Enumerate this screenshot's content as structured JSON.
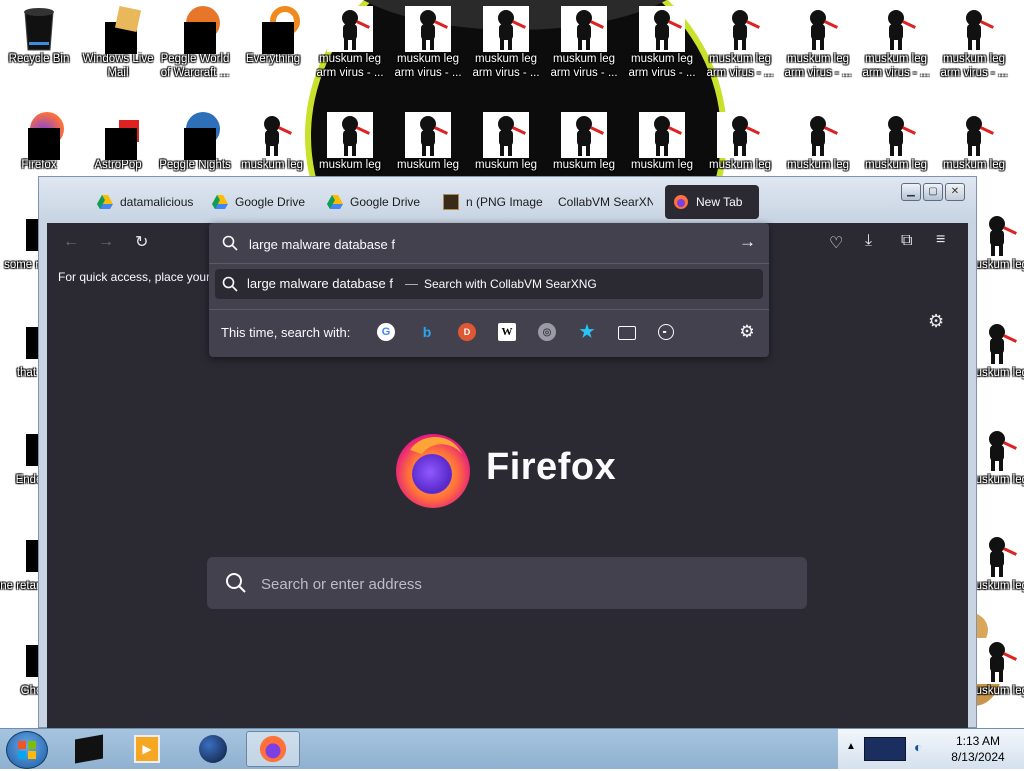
{
  "desktop": {
    "icons_row1": [
      {
        "label": "Recycle Bin"
      },
      {
        "label": "Windows Live Mail"
      },
      {
        "label": "Peggle World of Warcraft ..."
      },
      {
        "label": "Everything"
      },
      {
        "label": "muskum leg arm virus - ..."
      },
      {
        "label": "muskum leg arm virus - ..."
      },
      {
        "label": "muskum leg arm virus - ..."
      },
      {
        "label": "muskum leg arm virus - ..."
      },
      {
        "label": "muskum leg arm virus - ..."
      },
      {
        "label": "muskum leg arm virus - ..."
      },
      {
        "label": "muskum leg arm virus - ..."
      },
      {
        "label": "muskum leg arm virus - ..."
      },
      {
        "label": "muskum leg arm virus - ..."
      }
    ],
    "icons_row2": [
      {
        "label": "Firefox"
      },
      {
        "label": "AstroPop"
      },
      {
        "label": "Peggle Nights"
      },
      {
        "label": "muskum leg"
      },
      {
        "label": "muskum leg"
      },
      {
        "label": "muskum leg"
      },
      {
        "label": "muskum leg"
      },
      {
        "label": "muskum leg"
      },
      {
        "label": "muskum leg"
      },
      {
        "label": "muskum leg"
      },
      {
        "label": "muskum leg"
      },
      {
        "label": "muskum leg"
      },
      {
        "label": "muskum leg"
      }
    ],
    "left_col": [
      {
        "label": "some ran"
      },
      {
        "label": "that bu"
      },
      {
        "label": "Endem"
      },
      {
        "label": "none retards"
      },
      {
        "label": "Ghom"
      }
    ],
    "right_col": [
      {
        "label": "muskum leg"
      },
      {
        "label": "muskum leg"
      },
      {
        "label": "muskum leg"
      },
      {
        "label": "muskum leg"
      },
      {
        "label": "muskum leg"
      },
      {
        "label": "muskum leg"
      }
    ]
  },
  "browser": {
    "tabs": [
      {
        "label": "datamalicious",
        "icon": "google-drive-icon"
      },
      {
        "label": "Google Drive",
        "icon": "google-drive-icon"
      },
      {
        "label": "Google Drive",
        "icon": "google-drive-icon"
      },
      {
        "label": "n (PNG Image",
        "icon": "image-icon"
      },
      {
        "label": "CollabVM SearXN",
        "icon": "none"
      },
      {
        "label": "New Tab",
        "icon": "firefox-icon",
        "active": true
      }
    ],
    "tab_close": "×",
    "urlbar": {
      "value": "large malware database f",
      "go_icon": "→"
    },
    "suggestion": {
      "query": "large malware database f",
      "separator": "—",
      "action": "Search with CollabVM SearXNG"
    },
    "one_off": {
      "label": "This time, search with:",
      "engines": [
        "google-icon",
        "bing-icon",
        "duckduckgo-icon",
        "wikipedia-icon",
        "searxng-icon",
        "bookmarks-icon",
        "tabs-icon",
        "history-icon"
      ]
    },
    "bookmarks_toolbar_text": "For quick access, place your b",
    "new_tab": {
      "logo_text": "Firefox",
      "search_placeholder": "Search or enter address"
    }
  },
  "taskbar": {
    "time": "1:13 AM",
    "date": "8/13/2024"
  },
  "colors": {
    "firefox_bg": "#2b2a33",
    "panel_bg": "#42414d",
    "accent_blue": "#0060df",
    "taskbar": "#a6c4de"
  }
}
